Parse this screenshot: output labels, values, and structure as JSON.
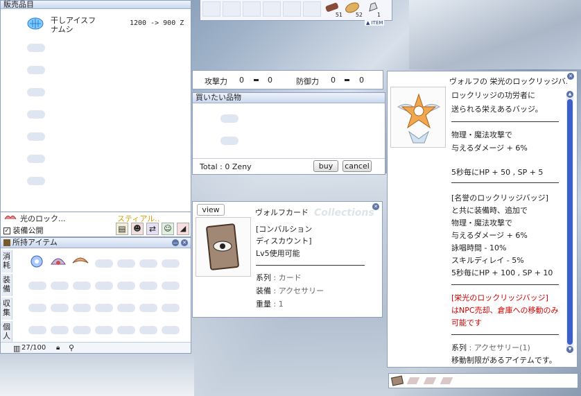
{
  "shop": {
    "title": "販売品目",
    "item_name_line1": "干しアイスフ",
    "item_name_line2": "ナムシ",
    "item_price": "1200 -> 900 Z"
  },
  "shortcut_bar": {
    "qty1": "51",
    "qty2": "52",
    "qty3": "1",
    "item_label": "▲ ITEM"
  },
  "stats": {
    "atk_label": "攻撃力",
    "atk_value1": "0",
    "atk_value2": "0",
    "def_label": "防御力",
    "def_value1": "0",
    "def_value2": "0"
  },
  "wishlist": {
    "title": "買いたい品物",
    "total": "Total : 0 Zeny",
    "buy_label": "buy",
    "cancel_label": "cancel"
  },
  "equip_strip": {
    "name": "光のロック...",
    "name2": "スティアル..",
    "public_label": "装備公開"
  },
  "inventory": {
    "title": "所持アイテム",
    "tabs": [
      "消耗",
      "装備",
      "収集",
      "個人"
    ],
    "capacity": "27/100"
  },
  "card": {
    "view_label": "view",
    "title": "ヴォルフカード",
    "line1": "[コンバルション",
    "line2": "ディスカウント]",
    "line3": "Lv5使用可能",
    "type_label": "系列",
    "type_value": "カード",
    "equip_label": "装備",
    "equip_value": "アクセサリー",
    "weight_label": "重量",
    "weight_value": "1",
    "watermark": "Collections"
  },
  "badge": {
    "title": "ヴォルフの 栄光のロックリッジバ...",
    "desc1": "ロックリッジの功労者に",
    "desc2": "送られる栄えあるバッジ。",
    "eff1": "物理・魔法攻撃で",
    "eff2": "与えるダメージ + 6%",
    "eff3": "5秒毎にHP + 50 , SP + 5",
    "set1": "[名誉のロックリッジバッジ]",
    "set2": "と共に装備時、追加で",
    "set3": "物理・魔法攻撃で",
    "set4": "与えるダメージ + 6%",
    "set5": "詠唱時間 - 10%",
    "set6": "スキルディレイ - 5%",
    "set7": "5秒毎にHP + 100 , SP + 10",
    "red1": "[栄光のロックリッジバッジ]",
    "red2": "はNPC売却、倉庫への移動のみ",
    "red3": "可能です",
    "type_label": "系列",
    "type_value": "アクセサリー(1)",
    "restrict": "移動制限があるアイテムです。"
  },
  "colors": {
    "window_border": "#8e9fbf",
    "title_gradient_top": "#eef3fb",
    "red_text": "#d40000"
  }
}
